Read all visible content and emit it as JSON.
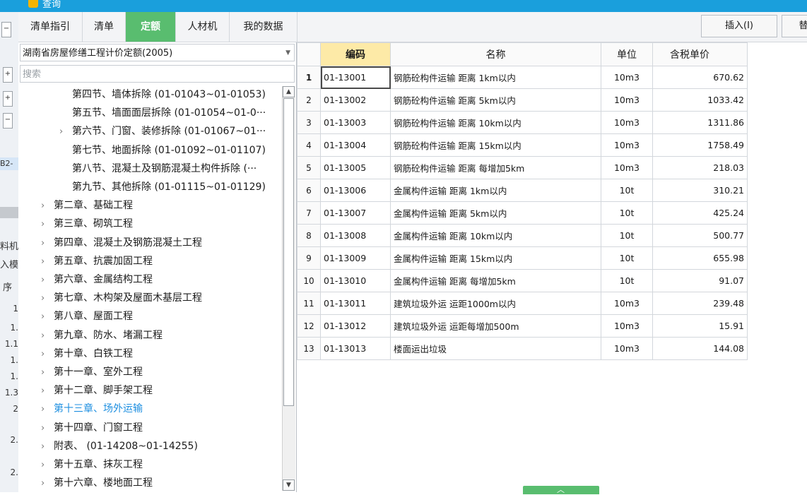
{
  "window": {
    "title": "查询"
  },
  "tabs": [
    {
      "label": "清单指引",
      "active": false
    },
    {
      "label": "清单",
      "active": false
    },
    {
      "label": "定额",
      "active": true
    },
    {
      "label": "人材机",
      "active": false
    },
    {
      "label": "我的数据",
      "active": false
    }
  ],
  "buttons": {
    "insert": "插入(I)",
    "replace": "替"
  },
  "left_panel": {
    "library": "湖南省房屋修缮工程计价定额(2005)",
    "search_placeholder": "搜索",
    "tree": [
      {
        "label": "第四节、墙体拆除 (01-01043~01-01053)",
        "level": 2,
        "has_children": false
      },
      {
        "label": "第五节、墙面面层拆除 (01-01054~01-0···",
        "level": 2,
        "has_children": false
      },
      {
        "label": "第六节、门窗、装修拆除 (01-01067~01···",
        "level": 2,
        "has_children": true
      },
      {
        "label": "第七节、地面拆除 (01-01092~01-01107)",
        "level": 2,
        "has_children": false
      },
      {
        "label": "第八节、混凝土及钢筋混凝土构件拆除 (···",
        "level": 2,
        "has_children": false
      },
      {
        "label": "第九节、其他拆除 (01-01115~01-01129)",
        "level": 2,
        "has_children": false
      },
      {
        "label": "第二章、基础工程",
        "level": 1,
        "has_children": true
      },
      {
        "label": "第三章、砌筑工程",
        "level": 1,
        "has_children": true
      },
      {
        "label": "第四章、混凝土及钢筋混凝土工程",
        "level": 1,
        "has_children": true
      },
      {
        "label": "第五章、抗震加固工程",
        "level": 1,
        "has_children": true
      },
      {
        "label": "第六章、金属结构工程",
        "level": 1,
        "has_children": true
      },
      {
        "label": "第七章、木构架及屋面木基层工程",
        "level": 1,
        "has_children": true
      },
      {
        "label": "第八章、屋面工程",
        "level": 1,
        "has_children": true
      },
      {
        "label": "第九章、防水、堵漏工程",
        "level": 1,
        "has_children": true
      },
      {
        "label": "第十章、白铁工程",
        "level": 1,
        "has_children": true
      },
      {
        "label": "第十一章、室外工程",
        "level": 1,
        "has_children": true
      },
      {
        "label": "第十二章、脚手架工程",
        "level": 1,
        "has_children": true
      },
      {
        "label": "第十三章、场外运输",
        "level": 1,
        "has_children": true,
        "highlighted": true
      },
      {
        "label": "第十四章、门窗工程",
        "level": 1,
        "has_children": true
      },
      {
        "label": "附表、 (01-14208~01-14255)",
        "level": 1,
        "has_children": true
      },
      {
        "label": "第十五章、抹灰工程",
        "level": 1,
        "has_children": true
      },
      {
        "label": "第十六章、楼地面工程",
        "level": 1,
        "has_children": true
      }
    ]
  },
  "grid": {
    "columns": [
      "编码",
      "名称",
      "单位",
      "含税单价"
    ],
    "rows": [
      {
        "no": "1",
        "code": "01-13001",
        "name": "钢筋砼构件运输 距离 1km以内",
        "unit": "10m3",
        "price": "670.62"
      },
      {
        "no": "2",
        "code": "01-13002",
        "name": "钢筋砼构件运输 距离 5km以内",
        "unit": "10m3",
        "price": "1033.42"
      },
      {
        "no": "3",
        "code": "01-13003",
        "name": "钢筋砼构件运输 距离 10km以内",
        "unit": "10m3",
        "price": "1311.86"
      },
      {
        "no": "4",
        "code": "01-13004",
        "name": "钢筋砼构件运输 距离 15km以内",
        "unit": "10m3",
        "price": "1758.49"
      },
      {
        "no": "5",
        "code": "01-13005",
        "name": "钢筋砼构件运输 距离 每增加5km",
        "unit": "10m3",
        "price": "218.03"
      },
      {
        "no": "6",
        "code": "01-13006",
        "name": "金属构件运输 距离 1km以内",
        "unit": "10t",
        "price": "310.21"
      },
      {
        "no": "7",
        "code": "01-13007",
        "name": "金属构件运输 距离 5km以内",
        "unit": "10t",
        "price": "425.24"
      },
      {
        "no": "8",
        "code": "01-13008",
        "name": "金属构件运输 距离 10km以内",
        "unit": "10t",
        "price": "500.77"
      },
      {
        "no": "9",
        "code": "01-13009",
        "name": "金属构件运输 距离 15km以内",
        "unit": "10t",
        "price": "655.98"
      },
      {
        "no": "10",
        "code": "01-13010",
        "name": "金属构件运输 距离 每增加5km",
        "unit": "10t",
        "price": "91.07"
      },
      {
        "no": "11",
        "code": "01-13011",
        "name": "建筑垃圾外运 运距1000m以内",
        "unit": "10m3",
        "price": "239.48"
      },
      {
        "no": "12",
        "code": "01-13012",
        "name": "建筑垃圾外运 运距每增加500m",
        "unit": "10m3",
        "price": "15.91"
      },
      {
        "no": "13",
        "code": "01-13013",
        "name": "楼面运出垃圾",
        "unit": "10m3",
        "price": "144.08"
      }
    ]
  },
  "background_fragments": [
    "B2-",
    "料机",
    "入模",
    "序",
    "1",
    "1.",
    "1.1",
    "1.",
    "1.",
    "1.3",
    "2",
    "2.",
    "2."
  ],
  "colors": {
    "accent_tab": "#59bd6f",
    "title_bar": "#1a9fdc",
    "highlight_text": "#1e8fe0",
    "sorted_header": "#fdeaa7"
  }
}
